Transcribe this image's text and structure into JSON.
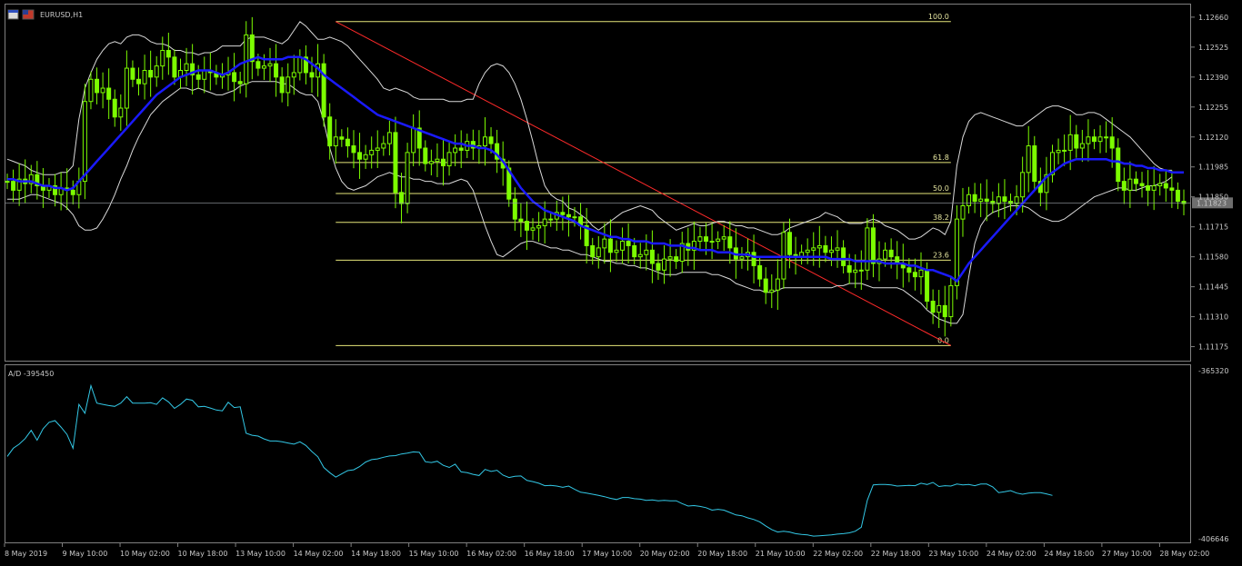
{
  "header": {
    "symbol": "EURUSD,H1"
  },
  "indicator": {
    "label": "A/D -395450"
  },
  "colors": {
    "background": "#000000",
    "candles": "#7CFC00",
    "ma": "#1a1aff",
    "bands": "#d9d9d9",
    "fib": "#e6e67a",
    "trendline": "#ff2a2a",
    "ad": "#33c8e6",
    "frame": "#808080"
  },
  "price_axis": {
    "ticks": [
      "1.12660",
      "1.12525",
      "1.12390",
      "1.12255",
      "1.12120",
      "1.11985",
      "1.11850",
      "1.11715",
      "1.11580",
      "1.11445",
      "1.11310",
      "1.11175"
    ],
    "current_price": "1.11823"
  },
  "ad_axis": {
    "top": "-365320",
    "bottom": "-406646"
  },
  "time_axis": [
    "8 May 2019",
    "9 May 10:00",
    "10 May 02:00",
    "10 May 18:00",
    "13 May 10:00",
    "14 May 02:00",
    "14 May 18:00",
    "15 May 10:00",
    "16 May 02:00",
    "16 May 18:00",
    "17 May 10:00",
    "20 May 02:00",
    "20 May 18:00",
    "21 May 10:00",
    "22 May 02:00",
    "22 May 18:00",
    "23 May 10:00",
    "24 May 02:00",
    "24 May 18:00",
    "27 May 10:00",
    "28 May 02:00"
  ],
  "fibonacci": {
    "levels": [
      {
        "label": "100.0",
        "price": 1.1264
      },
      {
        "label": "61.8",
        "price": 1.12005
      },
      {
        "label": "50.0",
        "price": 1.11865
      },
      {
        "label": "38.2",
        "price": 1.11735
      },
      {
        "label": "23.6",
        "price": 1.11565
      },
      {
        "label": "0.0",
        "price": 1.1118
      }
    ]
  },
  "chart_data": {
    "type": "candlestick",
    "symbol": "EURUSD",
    "timeframe": "H1",
    "ylim": [
      1.1112,
      1.1268
    ],
    "close": [
      1.1192,
      1.1188,
      1.1193,
      1.1191,
      1.1195,
      1.119,
      1.1188,
      1.119,
      1.1186,
      1.1189,
      1.1188,
      1.1186,
      1.1192,
      1.1228,
      1.1238,
      1.1232,
      1.1234,
      1.1229,
      1.1221,
      1.1225,
      1.1243,
      1.1238,
      1.1236,
      1.1242,
      1.1239,
      1.1244,
      1.1251,
      1.1248,
      1.1239,
      1.1242,
      1.1245,
      1.124,
      1.1238,
      1.1242,
      1.1241,
      1.1239,
      1.124,
      1.1241,
      1.1237,
      1.1236,
      1.1258,
      1.1246,
      1.1243,
      1.1244,
      1.1245,
      1.1239,
      1.1232,
      1.1239,
      1.1241,
      1.1248,
      1.1241,
      1.1239,
      1.1245,
      1.1221,
      1.1208,
      1.1212,
      1.1211,
      1.1208,
      1.1205,
      1.1202,
      1.1204,
      1.1206,
      1.1207,
      1.1209,
      1.1214,
      1.1187,
      1.1182,
      1.1205,
      1.1216,
      1.1207,
      1.12,
      1.1201,
      1.1202,
      1.1199,
      1.1205,
      1.1207,
      1.1206,
      1.121,
      1.1207,
      1.1208,
      1.1212,
      1.1209,
      1.1202,
      1.1198,
      1.1184,
      1.1175,
      1.1174,
      1.117,
      1.1171,
      1.1172,
      1.1175,
      1.1175,
      1.1178,
      1.1177,
      1.1176,
      1.1176,
      1.1172,
      1.1163,
      1.1158,
      1.1162,
      1.1166,
      1.116,
      1.1161,
      1.1165,
      1.1163,
      1.1158,
      1.1159,
      1.1161,
      1.1155,
      1.1152,
      1.1157,
      1.1158,
      1.1156,
      1.1164,
      1.1161,
      1.1165,
      1.1167,
      1.1165,
      1.1165,
      1.1166,
      1.1167,
      1.1162,
      1.1157,
      1.1158,
      1.116,
      1.1154,
      1.1148,
      1.1142,
      1.1143,
      1.1148,
      1.1169,
      1.1159,
      1.1158,
      1.116,
      1.1161,
      1.1162,
      1.1163,
      1.116,
      1.1161,
      1.1162,
      1.1154,
      1.1151,
      1.1152,
      1.1152,
      1.1171,
      1.1155,
      1.1157,
      1.1161,
      1.1158,
      1.1155,
      1.1153,
      1.1151,
      1.1149,
      1.1152,
      1.1138,
      1.1133,
      1.1136,
      1.1131,
      1.1145,
      1.1175,
      1.1181,
      1.1186,
      1.1183,
      1.1184,
      1.1183,
      1.1182,
      1.1185,
      1.1183,
      1.1182,
      1.1185,
      1.1196,
      1.1208,
      1.1192,
      1.1187,
      1.1195,
      1.1205,
      1.1206,
      1.1206,
      1.1213,
      1.1207,
      1.1209,
      1.1212,
      1.121,
      1.1212,
      1.1212,
      1.1207,
      1.1192,
      1.1188,
      1.1193,
      1.1191,
      1.119,
      1.1188,
      1.119,
      1.1191,
      1.1189,
      1.1188,
      1.1183,
      1.1182
    ],
    "ma": [
      1.1193,
      1.1193,
      1.1192,
      1.1192,
      1.1192,
      1.1191,
      1.119,
      1.119,
      1.1189,
      1.1189,
      1.1188,
      1.1189,
      1.1192,
      1.1195,
      1.1198,
      1.1201,
      1.1204,
      1.1207,
      1.121,
      1.1213,
      1.1216,
      1.1219,
      1.1222,
      1.1225,
      1.1228,
      1.1231,
      1.1233,
      1.1235,
      1.1237,
      1.1239,
      1.124,
      1.1241,
      1.1242,
      1.1242,
      1.1242,
      1.1241,
      1.124,
      1.1241,
      1.1243,
      1.1245,
      1.1246,
      1.1247,
      1.1248,
      1.1247,
      1.1247,
      1.1247,
      1.1247,
      1.1248,
      1.1248,
      1.1248,
      1.1247,
      1.1245,
      1.1243,
      1.124,
      1.1238,
      1.1236,
      1.1234,
      1.1232,
      1.123,
      1.1228,
      1.1226,
      1.1224,
      1.1222,
      1.1221,
      1.122,
      1.1219,
      1.1218,
      1.1217,
      1.1216,
      1.1215,
      1.1214,
      1.1213,
      1.1212,
      1.1211,
      1.121,
      1.1209,
      1.1209,
      1.1208,
      1.1208,
      1.1207,
      1.1207,
      1.1206,
      1.1204,
      1.1201,
      1.1197,
      1.1193,
      1.1189,
      1.1186,
      1.1183,
      1.1181,
      1.1179,
      1.1178,
      1.1177,
      1.1176,
      1.1175,
      1.1174,
      1.1172,
      1.1171,
      1.117,
      1.1169,
      1.1168,
      1.1167,
      1.1167,
      1.1166,
      1.1166,
      1.1165,
      1.1165,
      1.1165,
      1.1164,
      1.1164,
      1.1164,
      1.1163,
      1.1163,
      1.1163,
      1.1162,
      1.1162,
      1.1161,
      1.1161,
      1.1161,
      1.116,
      1.116,
      1.116,
      1.1159,
      1.1159,
      1.1159,
      1.1158,
      1.1158,
      1.1158,
      1.1158,
      1.1158,
      1.1158,
      1.1158,
      1.1158,
      1.1158,
      1.1158,
      1.1158,
      1.1158,
      1.1158,
      1.1157,
      1.1157,
      1.1157,
      1.1157,
      1.1156,
      1.1156,
      1.1156,
      1.1156,
      1.1156,
      1.1155,
      1.1155,
      1.1155,
      1.1155,
      1.1154,
      1.1154,
      1.1153,
      1.1152,
      1.1152,
      1.1151,
      1.115,
      1.1149,
      1.1147,
      1.1151,
      1.1155,
      1.1158,
      1.1161,
      1.1164,
      1.1167,
      1.117,
      1.1173,
      1.1176,
      1.1179,
      1.1182,
      1.1185,
      1.1188,
      1.1191,
      1.1194,
      1.1196,
      1.1198,
      1.12,
      1.1201,
      1.1202,
      1.1202,
      1.1202,
      1.1202,
      1.1202,
      1.1202,
      1.1201,
      1.1201,
      1.12,
      1.12,
      1.1199,
      1.1199,
      1.1198,
      1.1198,
      1.1197,
      1.1197,
      1.1196,
      1.1196,
      1.1196
    ],
    "bb_upper": [
      1.1202,
      1.1201,
      1.12,
      1.1199,
      1.1197,
      1.1196,
      1.1195,
      1.1195,
      1.1195,
      1.1196,
      1.1196,
      1.1199,
      1.122,
      1.1234,
      1.1241,
      1.1247,
      1.1251,
      1.1254,
      1.1255,
      1.1254,
      1.1257,
      1.1258,
      1.1258,
      1.1257,
      1.1255,
      1.1254,
      1.1254,
      1.1253,
      1.1251,
      1.1251,
      1.125,
      1.125,
      1.1249,
      1.125,
      1.125,
      1.1251,
      1.1253,
      1.1253,
      1.1253,
      1.1253,
      1.1256,
      1.1257,
      1.1257,
      1.1257,
      1.1256,
      1.1255,
      1.1254,
      1.1256,
      1.126,
      1.1264,
      1.1262,
      1.1259,
      1.1256,
      1.1256,
      1.1257,
      1.1256,
      1.1255,
      1.1253,
      1.125,
      1.1247,
      1.1244,
      1.1241,
      1.1238,
      1.1234,
      1.1233,
      1.1234,
      1.1233,
      1.1232,
      1.123,
      1.1229,
      1.1229,
      1.1229,
      1.1229,
      1.1229,
      1.1228,
      1.1228,
      1.1228,
      1.1229,
      1.1229,
      1.1236,
      1.1241,
      1.1244,
      1.1245,
      1.1244,
      1.1241,
      1.1236,
      1.1229,
      1.122,
      1.121,
      1.1199,
      1.119,
      1.1186,
      1.1184,
      1.1183,
      1.118,
      1.1179,
      1.1177,
      1.1175,
      1.1172,
      1.117,
      1.1172,
      1.1174,
      1.1176,
      1.1178,
      1.1179,
      1.118,
      1.1181,
      1.118,
      1.1179,
      1.1176,
      1.1174,
      1.1172,
      1.117,
      1.1171,
      1.1172,
      1.1173,
      1.1172,
      1.1172,
      1.1173,
      1.1174,
      1.1174,
      1.1173,
      1.1172,
      1.1172,
      1.1171,
      1.1171,
      1.117,
      1.1169,
      1.1168,
      1.1168,
      1.1169,
      1.1171,
      1.1172,
      1.1173,
      1.1174,
      1.1175,
      1.1176,
      1.1178,
      1.1177,
      1.1176,
      1.1174,
      1.1173,
      1.1173,
      1.1173,
      1.1174,
      1.1175,
      1.1174,
      1.1172,
      1.1171,
      1.117,
      1.1168,
      1.1166,
      1.1166,
      1.1167,
      1.1169,
      1.1171,
      1.117,
      1.1168,
      1.1174,
      1.1199,
      1.1212,
      1.1219,
      1.1222,
      1.1223,
      1.1222,
      1.1221,
      1.122,
      1.1219,
      1.1218,
      1.1217,
      1.1217,
      1.1219,
      1.1221,
      1.1223,
      1.1225,
      1.1226,
      1.1226,
      1.1225,
      1.1224,
      1.1222,
      1.1222,
      1.1223,
      1.1223,
      1.1222,
      1.122,
      1.1218,
      1.1216,
      1.1214,
      1.1212,
      1.1209,
      1.1206,
      1.1203,
      1.12,
      1.1198,
      1.1197,
      1.1197
    ],
    "bb_lower": [
      1.1184,
      1.1184,
      1.1184,
      1.1185,
      1.1186,
      1.1186,
      1.1185,
      1.1184,
      1.1183,
      1.1182,
      1.118,
      1.1177,
      1.1172,
      1.117,
      1.117,
      1.1171,
      1.1175,
      1.118,
      1.1186,
      1.1193,
      1.1199,
      1.1206,
      1.1212,
      1.1217,
      1.1222,
      1.1225,
      1.1228,
      1.123,
      1.1232,
      1.1234,
      1.1234,
      1.1233,
      1.1234,
      1.1233,
      1.1232,
      1.1231,
      1.1231,
      1.1232,
      1.1233,
      1.1235,
      1.1236,
      1.1237,
      1.1237,
      1.1237,
      1.1237,
      1.1237,
      1.1236,
      1.1236,
      1.1234,
      1.1232,
      1.1231,
      1.1231,
      1.1228,
      1.1219,
      1.1207,
      1.1198,
      1.1192,
      1.1189,
      1.1188,
      1.1189,
      1.119,
      1.1192,
      1.1194,
      1.1195,
      1.1196,
      1.1195,
      1.1194,
      1.1194,
      1.1193,
      1.1193,
      1.1192,
      1.1192,
      1.1191,
      1.1191,
      1.1191,
      1.1192,
      1.1193,
      1.1192,
      1.1188,
      1.118,
      1.1172,
      1.1165,
      1.1159,
      1.1158,
      1.116,
      1.1162,
      1.1164,
      1.1165,
      1.1165,
      1.1164,
      1.1163,
      1.1162,
      1.1162,
      1.1161,
      1.1161,
      1.116,
      1.1159,
      1.1159,
      1.1158,
      1.1157,
      1.1156,
      1.1156,
      1.1155,
      1.1155,
      1.1154,
      1.1154,
      1.1153,
      1.1153,
      1.1152,
      1.1151,
      1.115,
      1.115,
      1.115,
      1.1151,
      1.1151,
      1.1151,
      1.1151,
      1.1151,
      1.115,
      1.115,
      1.1149,
      1.1148,
      1.1146,
      1.1145,
      1.1144,
      1.1143,
      1.1143,
      1.1142,
      1.1142,
      1.1143,
      1.1144,
      1.1144,
      1.1144,
      1.1144,
      1.1144,
      1.1144,
      1.1144,
      1.1144,
      1.1144,
      1.1145,
      1.1145,
      1.1146,
      1.1146,
      1.1146,
      1.1145,
      1.1144,
      1.1144,
      1.1144,
      1.1144,
      1.1144,
      1.1143,
      1.1141,
      1.1139,
      1.1137,
      1.1134,
      1.1132,
      1.113,
      1.1129,
      1.1128,
      1.1128,
      1.1132,
      1.1149,
      1.1164,
      1.1172,
      1.1176,
      1.1178,
      1.1179,
      1.118,
      1.1181,
      1.1181,
      1.1181,
      1.118,
      1.1178,
      1.1176,
      1.1175,
      1.1174,
      1.1174,
      1.1175,
      1.1177,
      1.1179,
      1.1181,
      1.1183,
      1.1185,
      1.1186,
      1.1187,
      1.1188,
      1.1189,
      1.1189,
      1.1188,
      1.1188,
      1.1189,
      1.119,
      1.119,
      1.1191,
      1.1192,
      1.1194
    ],
    "indicator": {
      "name": "A/D",
      "last": -395450,
      "ylim": [
        -406646,
        -365320
      ],
      "values": [
        -386400,
        -384400,
        -383400,
        -382000,
        -380000,
        -382400,
        -379600,
        -378000,
        -377600,
        -379200,
        -381000,
        -384400,
        -373600,
        -375800,
        -369000,
        -373300,
        -373600,
        -373900,
        -374100,
        -373300,
        -371700,
        -373300,
        -373300,
        -373300,
        -373200,
        -373600,
        -372000,
        -373000,
        -374600,
        -373600,
        -372300,
        -372600,
        -374200,
        -374100,
        -374500,
        -375000,
        -375200,
        -373100,
        -374400,
        -374200,
        -380700,
        -381200,
        -381400,
        -382100,
        -382600,
        -382600,
        -382800,
        -383100,
        -383400,
        -382800,
        -383700,
        -385200,
        -386500,
        -389100,
        -390400,
        -391500,
        -390700,
        -389900,
        -389700,
        -388900,
        -387800,
        -387200,
        -387000,
        -386600,
        -386300,
        -386200,
        -385800,
        -385600,
        -385300,
        -385400,
        -387700,
        -387900,
        -387600,
        -388600,
        -389100,
        -388300,
        -390200,
        -390400,
        -390800,
        -391100,
        -389600,
        -390100,
        -389800,
        -391000,
        -391600,
        -391300,
        -391200,
        -392300,
        -392600,
        -393000,
        -393600,
        -393500,
        -393700,
        -394000,
        -393700,
        -394500,
        -395200,
        -395400,
        -395700,
        -396000,
        -396300,
        -396700,
        -397000,
        -396500,
        -396500,
        -396800,
        -396900,
        -397200,
        -397100,
        -397300,
        -397200,
        -397300,
        -397300,
        -398000,
        -398600,
        -398500,
        -398700,
        -399000,
        -399600,
        -399400,
        -399600,
        -400200,
        -400800,
        -401000,
        -401500,
        -401900,
        -402500,
        -403500,
        -404400,
        -405000,
        -404800,
        -405000,
        -405400,
        -405600,
        -405700,
        -406000,
        -405900,
        -405800,
        -405700,
        -405500,
        -405400,
        -405200,
        -404800,
        -403800,
        -397200,
        -393400,
        -393300,
        -393300,
        -393400,
        -393700,
        -393600,
        -393500,
        -393600,
        -393000,
        -393300,
        -392800,
        -393800,
        -393600,
        -393700,
        -393200,
        -393400,
        -393300,
        -393600,
        -393200,
        -393200,
        -393900,
        -395300,
        -395100,
        -394800,
        -395400,
        -395700,
        -395400,
        -395300,
        -395300,
        -395600,
        -396000
      ]
    }
  }
}
